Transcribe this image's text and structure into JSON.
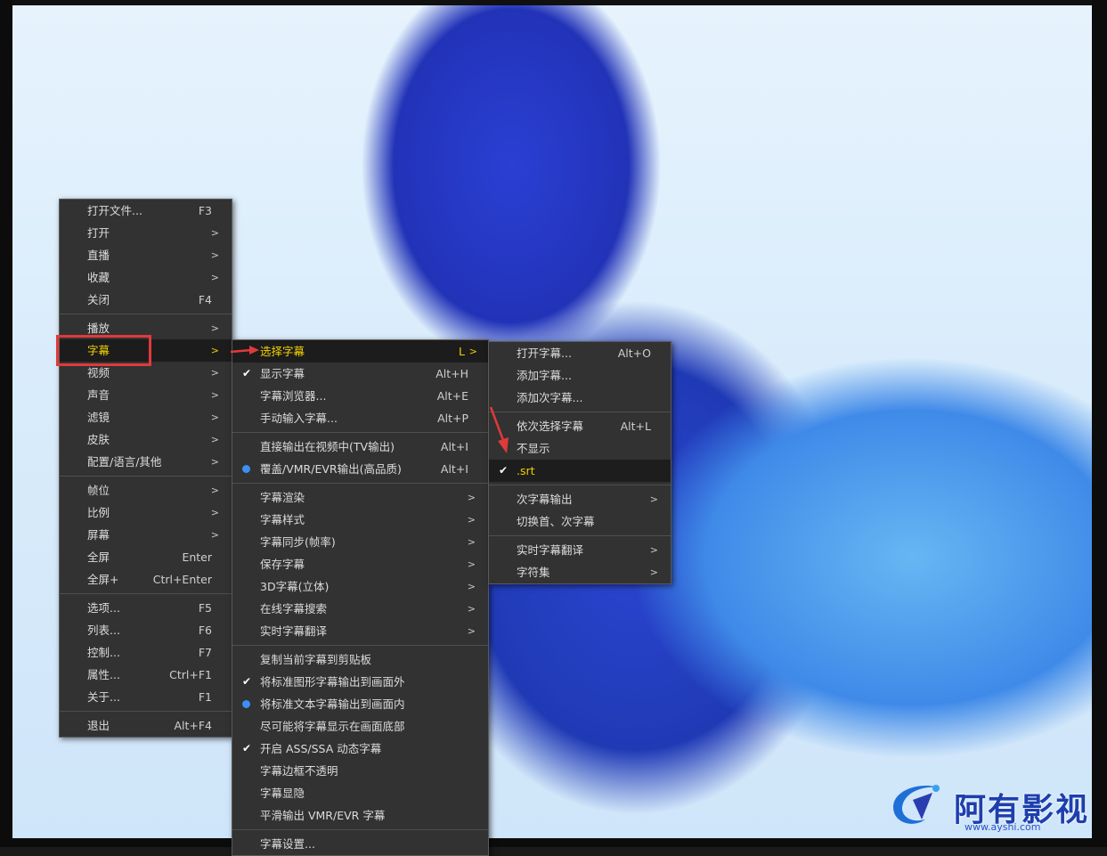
{
  "watermark": {
    "name": "阿有影视",
    "url": "www.ayshi.com"
  },
  "main_menu": [
    {
      "label": "打开文件...",
      "shortcut": "F3",
      "arrow": ""
    },
    {
      "label": "打开",
      "shortcut": "",
      "arrow": ">"
    },
    {
      "label": "直播",
      "shortcut": "",
      "arrow": ">"
    },
    {
      "label": "收藏",
      "shortcut": "",
      "arrow": ">"
    },
    {
      "label": "关闭",
      "shortcut": "F4",
      "arrow": ""
    },
    {
      "sep": true
    },
    {
      "label": "播放",
      "shortcut": "",
      "arrow": ">"
    },
    {
      "label": "字幕",
      "shortcut": "",
      "arrow": ">",
      "highlight": true
    },
    {
      "label": "视频",
      "shortcut": "",
      "arrow": ">"
    },
    {
      "label": "声音",
      "shortcut": "",
      "arrow": ">"
    },
    {
      "label": "滤镜",
      "shortcut": "",
      "arrow": ">"
    },
    {
      "label": "皮肤",
      "shortcut": "",
      "arrow": ">"
    },
    {
      "label": "配置/语言/其他",
      "shortcut": "",
      "arrow": ">"
    },
    {
      "sep": true
    },
    {
      "label": "帧位",
      "shortcut": "",
      "arrow": ">"
    },
    {
      "label": "比例",
      "shortcut": "",
      "arrow": ">"
    },
    {
      "label": "屏幕",
      "shortcut": "",
      "arrow": ">"
    },
    {
      "label": "全屏",
      "shortcut": "Enter",
      "arrow": ""
    },
    {
      "label": "全屏+",
      "shortcut": "Ctrl+Enter",
      "arrow": ""
    },
    {
      "sep": true
    },
    {
      "label": "选项...",
      "shortcut": "F5",
      "arrow": ""
    },
    {
      "label": "列表...",
      "shortcut": "F6",
      "arrow": ""
    },
    {
      "label": "控制...",
      "shortcut": "F7",
      "arrow": ""
    },
    {
      "label": "属性...",
      "shortcut": "Ctrl+F1",
      "arrow": ""
    },
    {
      "label": "关于...",
      "shortcut": "F1",
      "arrow": ""
    },
    {
      "sep": true
    },
    {
      "label": "退出",
      "shortcut": "Alt+F4",
      "arrow": ""
    }
  ],
  "subtitle_menu": [
    {
      "label": "选择字幕",
      "shortcut": "L",
      "arrow": ">",
      "highlight": true
    },
    {
      "label": "显示字幕",
      "shortcut": "Alt+H",
      "mark": "check"
    },
    {
      "label": "字幕浏览器...",
      "shortcut": "Alt+E"
    },
    {
      "label": "手动输入字幕...",
      "shortcut": "Alt+P"
    },
    {
      "sep": true
    },
    {
      "label": "直接输出在视频中(TV输出)",
      "shortcut": "Alt+I"
    },
    {
      "label": "覆盖/VMR/EVR输出(高品质)",
      "shortcut": "Alt+I",
      "mark": "dot"
    },
    {
      "sep": true
    },
    {
      "label": "字幕渲染",
      "arrow": ">"
    },
    {
      "label": "字幕样式",
      "arrow": ">"
    },
    {
      "label": "字幕同步(帧率)",
      "arrow": ">"
    },
    {
      "label": "保存字幕",
      "arrow": ">"
    },
    {
      "label": "3D字幕(立体)",
      "arrow": ">"
    },
    {
      "label": "在线字幕搜索",
      "arrow": ">"
    },
    {
      "label": "实时字幕翻译",
      "arrow": ">"
    },
    {
      "sep": true
    },
    {
      "label": "复制当前字幕到剪贴板"
    },
    {
      "label": "将标准图形字幕输出到画面外",
      "mark": "check"
    },
    {
      "label": "将标准文本字幕输出到画面内",
      "mark": "dot"
    },
    {
      "label": "尽可能将字幕显示在画面底部"
    },
    {
      "label": "开启 ASS/SSA 动态字幕",
      "mark": "check"
    },
    {
      "label": "字幕边框不透明"
    },
    {
      "label": "字幕显隐"
    },
    {
      "label": "平滑输出 VMR/EVR 字幕"
    },
    {
      "sep": true
    },
    {
      "label": "字幕设置..."
    }
  ],
  "select_menu": [
    {
      "label": "打开字幕...",
      "shortcut": "Alt+O"
    },
    {
      "label": "添加字幕..."
    },
    {
      "label": "添加次字幕..."
    },
    {
      "sep": true
    },
    {
      "label": "依次选择字幕",
      "shortcut": "Alt+L"
    },
    {
      "label": "不显示"
    },
    {
      "label": ".srt",
      "mark": "check",
      "selected": true
    },
    {
      "sep": true
    },
    {
      "label": "次字幕输出",
      "arrow": ">"
    },
    {
      "label": "切换首、次字幕"
    },
    {
      "sep": true
    },
    {
      "label": "实时字幕翻译",
      "arrow": ">"
    },
    {
      "label": "字符集",
      "arrow": ">"
    }
  ],
  "colors": {
    "highlight_text": "#f0d000",
    "annotation": "#e03a3a",
    "radio": "#3d8ef5",
    "menu_bg": "#323232"
  }
}
